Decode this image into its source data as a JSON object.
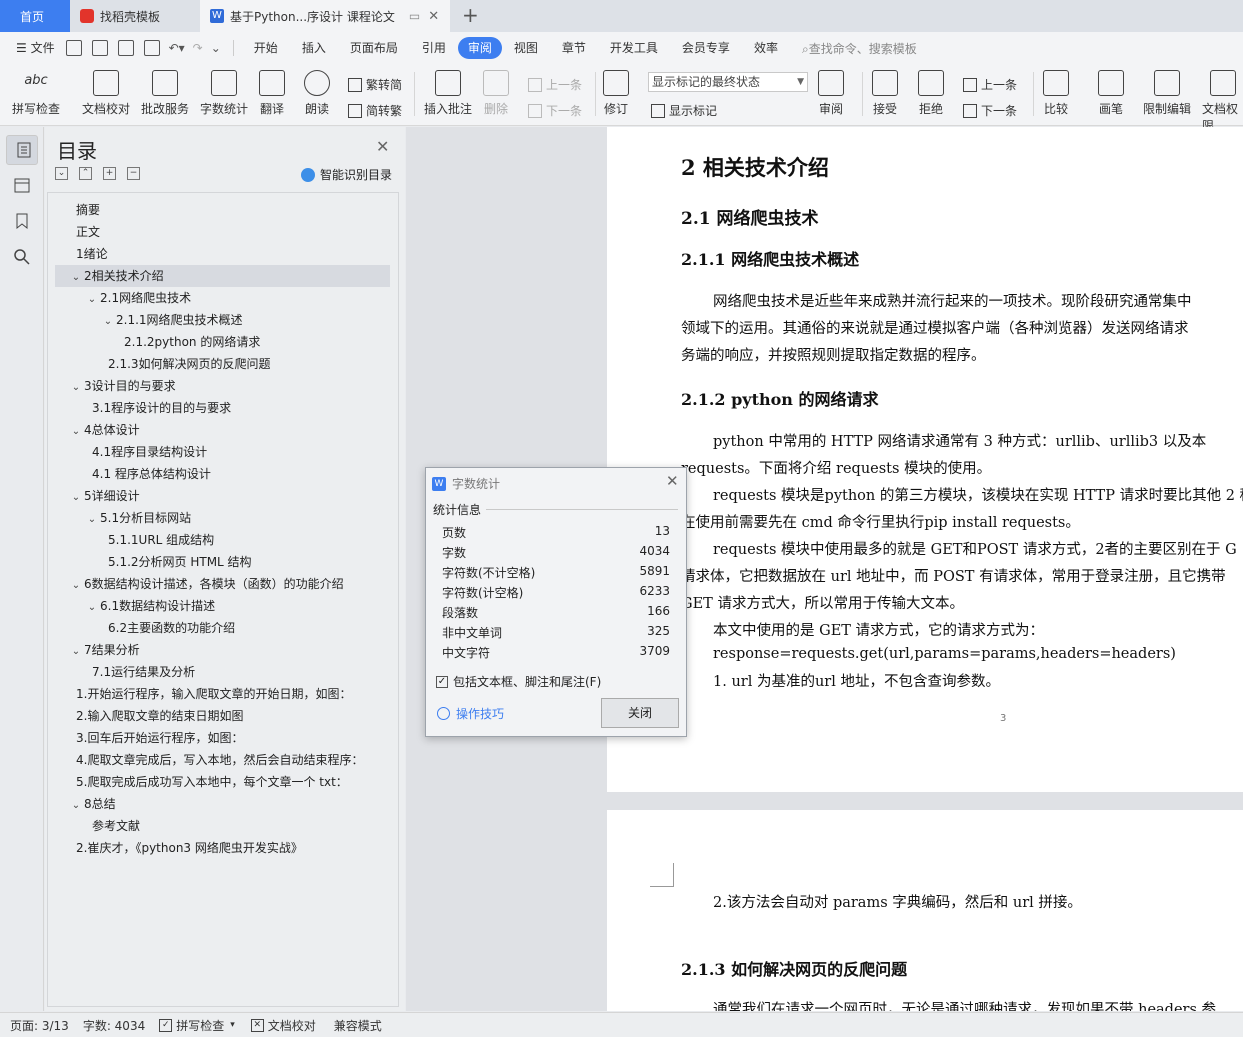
{
  "tabs": {
    "home": "首页",
    "template": "找稻壳模板",
    "doc": "基于Python...序设计 课程论文"
  },
  "menu": {
    "file": "文件",
    "items": [
      "开始",
      "插入",
      "页面布局",
      "引用",
      "审阅",
      "视图",
      "章节",
      "开发工具",
      "会员专享",
      "效率"
    ],
    "search": "查找命令、搜索模板"
  },
  "ribbon": {
    "spell": "拼写检查",
    "proof": "文档校对",
    "correct": "批改服务",
    "wordcount": "字数统计",
    "translate": "翻译",
    "read": "朗读",
    "trad": "繁转简",
    "simp": "简转繁",
    "comment": "插入批注",
    "delete": "删除",
    "prev": "上一条",
    "next": "下一条",
    "revise": "修订",
    "markup_state": "显示标记的最终状态",
    "show_markup": "显示标记",
    "review": "审阅",
    "accept": "接受",
    "reject": "拒绝",
    "prev2": "上一条",
    "next2": "下一条",
    "compare": "比较",
    "pen": "画笔",
    "restrict": "限制编辑",
    "permission": "文档权限"
  },
  "toc": {
    "title": "目录",
    "smart": "智能识别目录",
    "items": [
      {
        "text": "摘要",
        "lvl": 0,
        "car": ""
      },
      {
        "text": "正文",
        "lvl": 0,
        "car": ""
      },
      {
        "text": "1绪论",
        "lvl": 0,
        "car": ""
      },
      {
        "text": "2相关技术介绍",
        "lvl": 0,
        "car": "v"
      },
      {
        "text": "2.1网络爬虫技术",
        "lvl": 1,
        "car": "v"
      },
      {
        "text": "2.1.1网络爬虫技术概述",
        "lvl": 2,
        "car": "v"
      },
      {
        "text": "2.1.2python 的网络请求",
        "lvl": 3,
        "car": ""
      },
      {
        "text": "2.1.3如何解决网页的反爬问题",
        "lvl": 2,
        "car": ""
      },
      {
        "text": "3设计目的与要求",
        "lvl": 0,
        "car": "v"
      },
      {
        "text": "3.1程序设计的目的与要求",
        "lvl": 1,
        "car": ""
      },
      {
        "text": "4总体设计",
        "lvl": 0,
        "car": "v"
      },
      {
        "text": "4.1程序目录结构设计",
        "lvl": 1,
        "car": ""
      },
      {
        "text": "4.1 程序总体结构设计",
        "lvl": 1,
        "car": ""
      },
      {
        "text": "5详细设计",
        "lvl": 0,
        "car": "v"
      },
      {
        "text": "5.1分析目标网站",
        "lvl": 1,
        "car": "v"
      },
      {
        "text": "5.1.1URL 组成结构",
        "lvl": 2,
        "car": ""
      },
      {
        "text": "5.1.2分析网页 HTML 结构",
        "lvl": 2,
        "car": ""
      },
      {
        "text": "6数据结构设计描述，各模块（函数）的功能介绍",
        "lvl": 0,
        "car": "v"
      },
      {
        "text": "6.1数据结构设计描述",
        "lvl": 1,
        "car": "v"
      },
      {
        "text": "6.2主要函数的功能介绍",
        "lvl": 2,
        "car": ""
      },
      {
        "text": "7结果分析",
        "lvl": 0,
        "car": "v"
      },
      {
        "text": "7.1运行结果及分析",
        "lvl": 1,
        "car": ""
      },
      {
        "text": "1.开始运行程序，输入爬取文章的开始日期，如图：",
        "lvl": 0,
        "car": ""
      },
      {
        "text": "2.输入爬取文章的结束日期如图",
        "lvl": 0,
        "car": ""
      },
      {
        "text": "3.回车后开始运行程序，如图：",
        "lvl": 0,
        "car": ""
      },
      {
        "text": "4.爬取文章完成后，写入本地，然后会自动结束程序：",
        "lvl": 0,
        "car": ""
      },
      {
        "text": "5.爬取完成后成功写入本地中，每个文章一个 txt：",
        "lvl": 0,
        "car": ""
      },
      {
        "text": "8总结",
        "lvl": 0,
        "car": "v"
      },
      {
        "text": "参考文献",
        "lvl": 1,
        "car": ""
      },
      {
        "text": "2.崔庆才，《python3 网络爬虫开发实战》",
        "lvl": 0,
        "car": ""
      }
    ]
  },
  "doc": {
    "h1": "2  相关技术介绍",
    "h2": "2.1  网络爬虫技术",
    "h3a": "2.1.1 网络爬虫技术概述",
    "p1a": "网络爬虫技术是近些年来成熟并流行起来的一项技术。现阶段研究通常集中",
    "p1b": "领域下的运用。其通俗的来说就是通过模拟客户端（各种浏览器）发送网络请求",
    "p1c": "务端的响应，并按照规则提取指定数据的程序。",
    "h3b": "2.1.2 python 的网络请求",
    "p2a": "python 中常用的 HTTP 网络请求通常有 3 种方式：urllib、urllib3 以及本",
    "p2b": "requests。下面将介绍 requests 模块的使用。",
    "p3a": "requests 模块是python 的第三方模块，该模块在实现 HTTP 请求时要比其他 2 种",
    "p3b": "在使用前需要先在 cmd 命令行里执行pip install requests。",
    "p4a": "requests 模块中使用最多的就是 GET和POST 请求方式，2者的主要区别在于 G",
    "p4b": "请求体，它把数据放在 url 地址中，而 POST 有请求体，常用于登录注册，且它携带",
    "p4c": "GET 请求方式大，所以常用于传输大文本。",
    "p5": "本文中使用的是 GET 请求方式，它的请求方式为：",
    "code": "response=requests.get(url,params=params,headers=headers)",
    "li1": "1.  url 为基准的url 地址，不包含查询参数。",
    "pagenum": "3",
    "p6": "2.该方法会自动对 params 字典编码，然后和 url 拼接。",
    "h3c": "2.1.3 如何解决网页的反爬问题",
    "p7": "通常我们在请求一个网页时，无论是通过哪种请求，发现如果不带 headers 参"
  },
  "dialog": {
    "title": "字数统计",
    "section": "统计信息",
    "rows": [
      {
        "label": "页数",
        "value": "13"
      },
      {
        "label": "字数",
        "value": "4034"
      },
      {
        "label": "字符数(不计空格)",
        "value": "5891"
      },
      {
        "label": "字符数(计空格)",
        "value": "6233"
      },
      {
        "label": "段落数",
        "value": "166"
      },
      {
        "label": "非中文单词",
        "value": "325"
      },
      {
        "label": "中文字符",
        "value": "3709"
      }
    ],
    "include": "包括文本框、脚注和尾注(F)",
    "tips": "操作技巧",
    "close": "关闭"
  },
  "status": {
    "page": "页面: 3/13",
    "words": "字数: 4034",
    "spell": "拼写检查",
    "proof": "文档校对",
    "compat": "兼容模式"
  }
}
